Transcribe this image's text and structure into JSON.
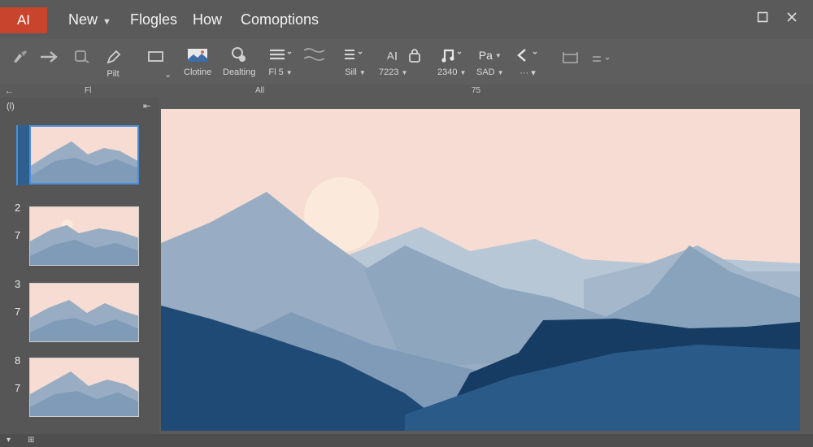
{
  "app": {
    "badge": "AI"
  },
  "menus": [
    {
      "label": "New",
      "has_dropdown": true
    },
    {
      "label": "Flogles"
    },
    {
      "label": "How"
    },
    {
      "label": "Comoptions"
    }
  ],
  "ribbon": {
    "buttons": [
      {
        "label": "",
        "icon": "brush-icon"
      },
      {
        "label": "",
        "icon": "arrow-right-icon"
      },
      {
        "label": "",
        "icon": "shape-icon"
      },
      {
        "label": "Pilt",
        "icon": "pen-icon"
      },
      {
        "label": "",
        "icon": "rectangle-icon"
      },
      {
        "label": "Clotine",
        "icon": "image-icon"
      },
      {
        "label": "Dealting",
        "icon": "pin-icon"
      },
      {
        "label": "Fl 5",
        "icon": "list-icon"
      },
      {
        "label": "",
        "icon": "wave-icon"
      },
      {
        "label": "Sill",
        "icon": "align-icon"
      },
      {
        "label": "7223",
        "icon": "text-size-icon"
      },
      {
        "label": "2340",
        "icon": "music-note-icon"
      },
      {
        "label": "SAD",
        "icon": "pa-icon"
      },
      {
        "label": "",
        "icon": "chevron-left-icon"
      },
      {
        "label": "",
        "icon": "frame-icon"
      },
      {
        "label": "",
        "icon": "equals-icon"
      }
    ],
    "misc_text": "Pa",
    "group_labels": [
      "Fl",
      "All",
      "75"
    ]
  },
  "thumbnails": {
    "pane_label": "(l)",
    "numbers": [
      {
        "a": "2",
        "b": "7"
      },
      {
        "a": "3",
        "b": "7"
      },
      {
        "a": "8",
        "b": "7"
      }
    ]
  },
  "colors": {
    "sky": "#f6dcd2",
    "sun": "#fbe9dc",
    "far_mountain": "#b8c7d6",
    "mid_mountain": "#98adc3",
    "near_mountain": "#7f9bb8",
    "deep_blue": "#1f4a76",
    "navy": "#163c64",
    "accent": "#c8442c",
    "selection": "#4a90d9"
  }
}
